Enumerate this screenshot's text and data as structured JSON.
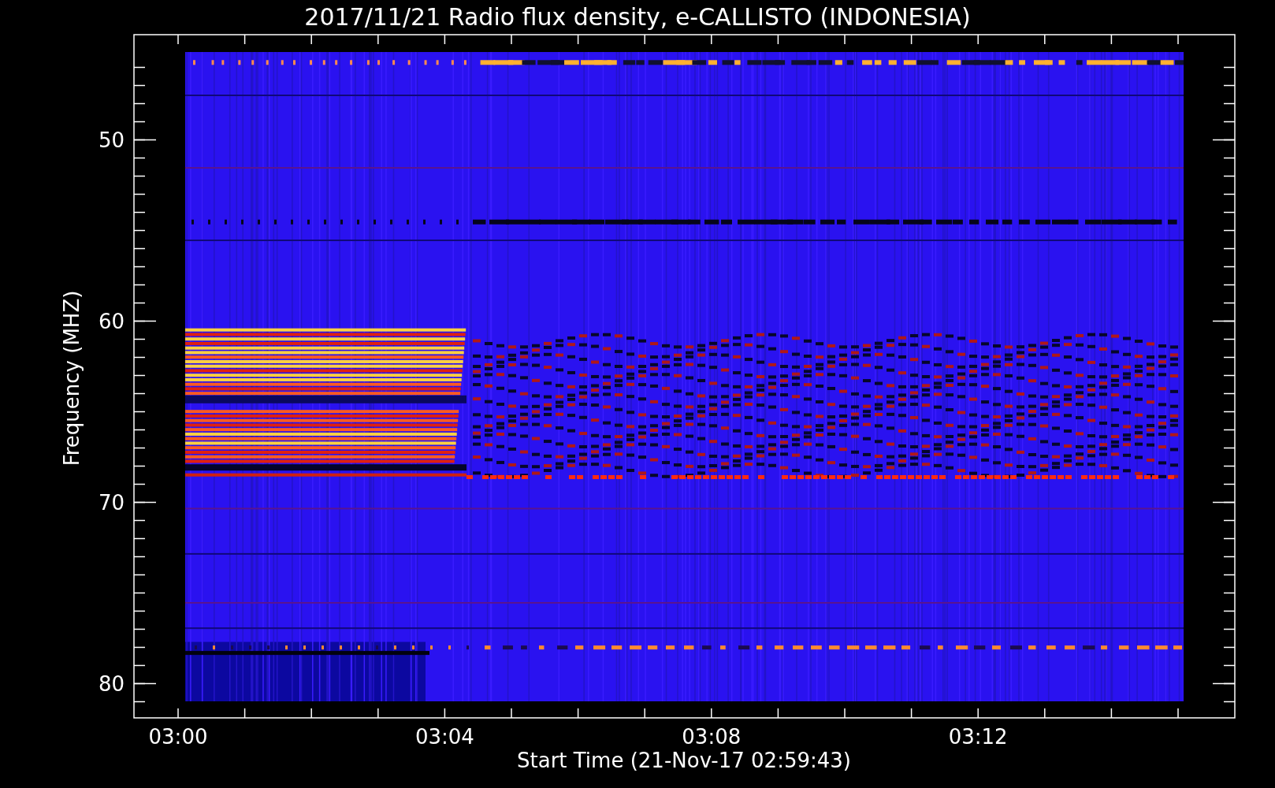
{
  "title": "2017/11/21  Radio flux density, e-CALLISTO (INDONESIA)",
  "y_axis": {
    "label": "Frequency (MHZ)",
    "ticks": [
      "50",
      "60",
      "70",
      "80"
    ]
  },
  "x_axis": {
    "label": "Start Time (21-Nov-17 02:59:43)",
    "ticks": [
      "03:00",
      "03:04",
      "03:08",
      "03:12"
    ]
  }
}
